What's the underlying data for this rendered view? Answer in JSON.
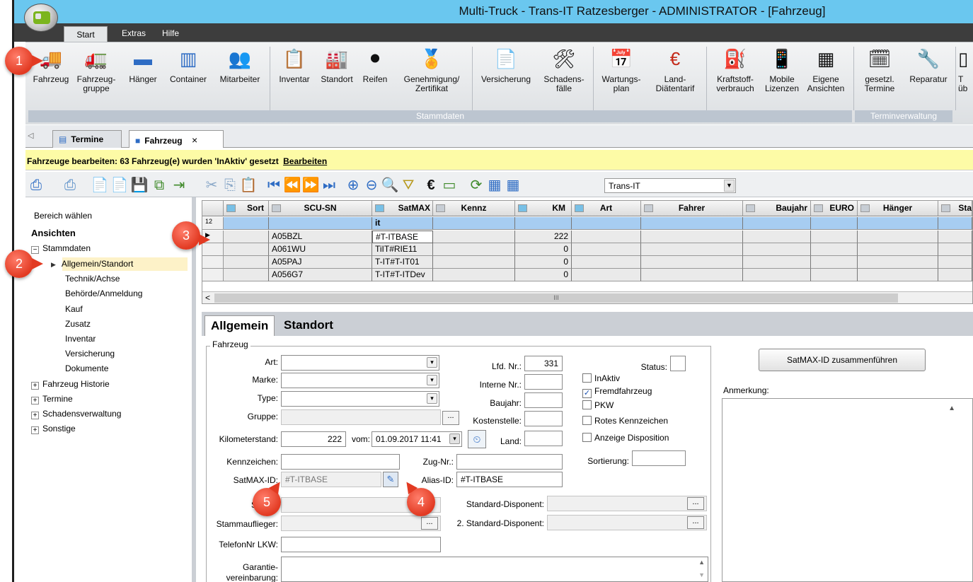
{
  "window": {
    "title": "Multi-Truck - Trans-IT Ratzesberger - ADMINISTRATOR - [Fahrzeug]"
  },
  "menu": {
    "tabs": [
      "Start",
      "Extras",
      "Hilfe"
    ]
  },
  "ribbon": {
    "buttons": [
      {
        "label": "Fahrzeug",
        "icon": "truck-icon"
      },
      {
        "label": "Fahrzeug-\ngruppe",
        "icon": "truck-group-icon"
      },
      {
        "label": "Hänger",
        "icon": "trailer-icon"
      },
      {
        "label": "Container",
        "icon": "container-icon"
      },
      {
        "label": "Mitarbeiter",
        "icon": "employee-icon"
      },
      {
        "label": "Inventar",
        "icon": "clipboard-icon"
      },
      {
        "label": "Standort",
        "icon": "factory-icon"
      },
      {
        "label": "Reifen",
        "icon": "tire-icon"
      },
      {
        "label": "Genehmigung/\nZertifikat",
        "icon": "certificate-icon"
      },
      {
        "label": "Versicherung",
        "icon": "document-icon"
      },
      {
        "label": "Schadens-\nfälle",
        "icon": "damage-icon"
      },
      {
        "label": "Wartungs-\nplan",
        "icon": "maintenance-calendar-icon"
      },
      {
        "label": "Land-\nDiätentarif",
        "icon": "euro-globe-icon"
      },
      {
        "label": "Kraftstoff-\nverbrauch",
        "icon": "fuel-pump-icon"
      },
      {
        "label": "Mobile\nLizenzen",
        "icon": "mobile-phone-icon"
      },
      {
        "label": "Eigene\nAnsichten",
        "icon": "custom-views-icon"
      },
      {
        "label": "gesetzl.\nTermine",
        "icon": "calendar-clock-icon"
      },
      {
        "label": "Reparatur",
        "icon": "repair-truck-icon"
      },
      {
        "label": "T\nüb",
        "icon": "partial-icon"
      }
    ],
    "groups": [
      "Stammdaten",
      "Terminverwaltung"
    ]
  },
  "doctabs": [
    "Termine",
    "Fahrzeug",
    "×"
  ],
  "notice": {
    "text": "Fahrzeuge bearbeiten: 63 Fahrzeug(e) wurden 'InAktiv' gesetzt",
    "link": "Bearbeiten"
  },
  "toolbar": {
    "combo_value": "Trans-IT"
  },
  "sidebar": {
    "header": "Bereich wählen",
    "section": "Ansichten",
    "items": [
      {
        "label": "Stammdaten",
        "expander": "−"
      },
      {
        "label": "Allgemein/Standort",
        "marker": "▶"
      },
      {
        "label": "Technik/Achse"
      },
      {
        "label": "Behörde/Anmeldung"
      },
      {
        "label": "Kauf"
      },
      {
        "label": "Zusatz"
      },
      {
        "label": "Inventar"
      },
      {
        "label": "Versicherung"
      },
      {
        "label": "Dokumente"
      },
      {
        "label": "Fahrzeug Historie",
        "expander": "+"
      },
      {
        "label": "Termine",
        "expander": "+"
      },
      {
        "label": "Schadensverwaltung",
        "expander": "+"
      },
      {
        "label": "Sonstige",
        "expander": "+"
      }
    ]
  },
  "grid": {
    "columns": [
      "Sort",
      "SCU-SN",
      "SatMAX",
      "Kennz",
      "KM",
      "Art",
      "Fahrer",
      "Baujahr",
      "EURO",
      "Hänger",
      "Sta"
    ],
    "filter_row": {
      "count": "12",
      "satmax": "it"
    },
    "rows": [
      {
        "marker": "▶",
        "scu": "A05BZL",
        "satmax": "#T-ITBASE",
        "km": "222"
      },
      {
        "marker": "",
        "scu": "A061WU",
        "satmax": "TiIT#RIE11",
        "km": "0"
      },
      {
        "marker": "",
        "scu": "A05PAJ",
        "satmax": "T-IT#T-IT01",
        "km": "0"
      },
      {
        "marker": "",
        "scu": "A056G7",
        "satmax": "T-IT#T-ITDev",
        "km": "0"
      }
    ],
    "scroll_left": "<",
    "scroll_mid": "III"
  },
  "detail": {
    "tabs": [
      "Allgemein",
      "Standort"
    ],
    "fieldset": "Fahrzeug",
    "labels": {
      "art": "Art:",
      "marke": "Marke:",
      "type": "Type:",
      "gruppe": "Gruppe:",
      "km": "Kilometerstand:",
      "vom": "vom:",
      "kennzeichen": "Kennzeichen:",
      "satmax": "SatMAX-ID:",
      "stamm": "Stamm",
      "stammauflieger": "Stammauflieger:",
      "telefon": "TelefonNr LKW:",
      "garantie": "Garantie-\nvereinbarung:",
      "lfd": "Lfd. Nr.:",
      "interne": "Interne Nr.:",
      "baujahr": "Baujahr:",
      "kostenstelle": "Kostenstelle:",
      "land": "Land:",
      "zug": "Zug-Nr.:",
      "alias": "Alias-ID:",
      "disponent": "Standard-Disponent:",
      "disponent2": "2. Standard-Disponent:",
      "status": "Status:",
      "sortierung": "Sortierung:",
      "anmerkung": "Anmerkung:"
    },
    "values": {
      "lfd": "331",
      "km": "222",
      "vom": "01.09.2017 11:41",
      "satmax": "#T-ITBASE",
      "alias": "#T-ITBASE"
    },
    "checkboxes": [
      {
        "label": "InAktiv",
        "checked": false
      },
      {
        "label": "Fremdfahrzeug",
        "checked": true
      },
      {
        "label": "PKW",
        "checked": false
      },
      {
        "label": "Rotes Kennzeichen",
        "checked": false
      },
      {
        "label": "Anzeige Disposition",
        "checked": false
      }
    ],
    "merge_button": "SatMAX-ID zusammenführen",
    "dots": "..."
  },
  "badges": [
    "1",
    "2",
    "3",
    "4",
    "5"
  ],
  "colors": {
    "titlebar": "#6ac7ef",
    "notice": "#fdfba6",
    "selected": "#fdf2c8",
    "badge": "#e23a22",
    "filter": "#a7cdf1"
  }
}
